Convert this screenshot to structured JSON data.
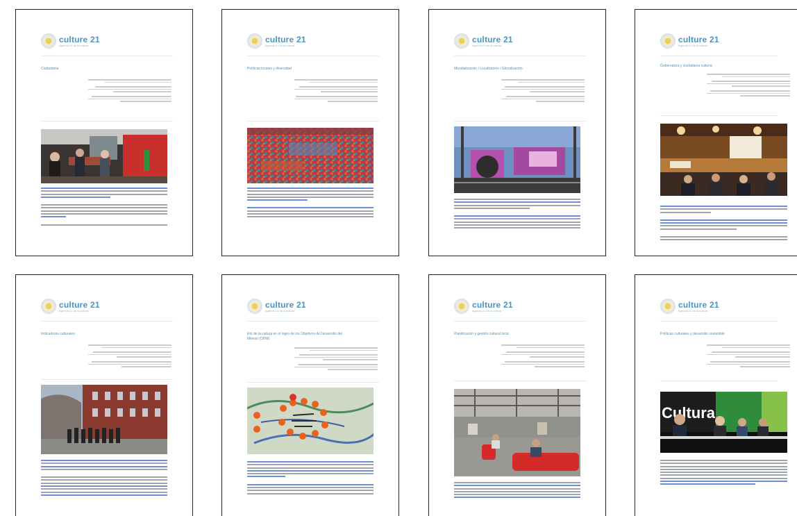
{
  "pages": [
    {
      "logo": "culture 21",
      "tagline": "Agenda 21 de la cultura",
      "title": "Ciudadanía"
    },
    {
      "logo": "culture 21",
      "tagline": "Agenda 21 de la cultura",
      "title": "Políticas locales y diversidad"
    },
    {
      "logo": "culture 21",
      "tagline": "Agenda 21 de la cultura",
      "title": "Mundialización / Localización / Glocalización"
    },
    {
      "logo": "culture 21",
      "tagline": "Agenda 21 de la cultura",
      "title": "Gobernanza y ciudadanía cultural"
    },
    {
      "logo": "culture 21",
      "tagline": "Agenda 21 de la cultura",
      "title": "Indicadores culturales"
    },
    {
      "logo": "culture 21",
      "tagline": "Agenda 21 de la cultura",
      "title": "Rol de la cultura en el logro de los Objetivos de Desarrollo del Milenio (ODM)"
    },
    {
      "logo": "culture 21",
      "tagline": "Agenda 21 de la cultura",
      "title": "Planificación y gestión cultural local"
    },
    {
      "logo": "culture 21",
      "tagline": "Agenda 21 de la cultura",
      "title": "Políticas culturales y desarrollo sostenible"
    }
  ],
  "photo_banner_text": "Cultura"
}
